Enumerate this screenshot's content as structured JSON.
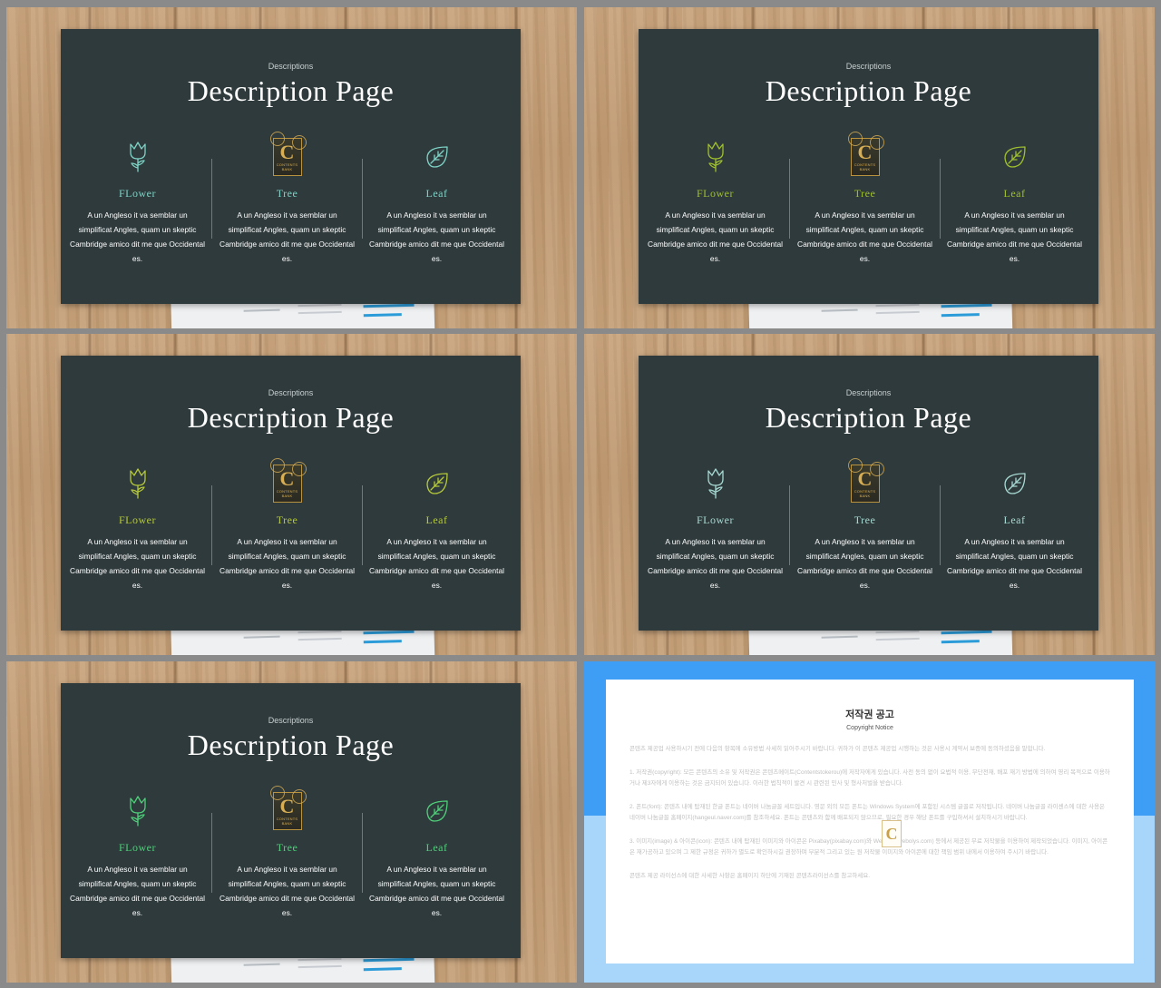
{
  "slides": [
    {
      "kicker": "Descriptions",
      "title": "Description Page",
      "accent": "#7ed3c6",
      "columns": [
        {
          "name": "FLower",
          "icon": "tulip-icon",
          "text": "A un Angleso it va semblar un simplificat Angles, quam un skeptic Cambridge amico dit me que Occidental es."
        },
        {
          "name": "Tree",
          "icon": "contents-logo",
          "text": "A un Angleso it va semblar un simplificat Angles, quam un skeptic Cambridge amico dit me que Occidental es."
        },
        {
          "name": "Leaf",
          "icon": "leaf-icon",
          "text": "A un Angleso it va semblar un simplificat Angles, quam un skeptic Cambridge amico dit me que Occidental es."
        }
      ]
    },
    {
      "kicker": "Descriptions",
      "title": "Description Page",
      "accent": "#9fbf2e",
      "columns": [
        {
          "name": "FLower",
          "icon": "tulip-icon",
          "text": "A un Angleso it va semblar un simplificat Angles, quam un skeptic Cambridge amico dit me que Occidental es."
        },
        {
          "name": "Tree",
          "icon": "contents-logo",
          "text": "A un Angleso it va semblar un simplificat Angles, quam un skeptic Cambridge amico dit me que Occidental es."
        },
        {
          "name": "Leaf",
          "icon": "leaf-icon",
          "text": "A un Angleso it va semblar un simplificat Angles, quam un skeptic Cambridge amico dit me que Occidental es."
        }
      ]
    },
    {
      "kicker": "Descriptions",
      "title": "Description Page",
      "accent": "#b5c93a",
      "columns": [
        {
          "name": "FLower",
          "icon": "tulip-icon",
          "text": "A un Angleso it va semblar un simplificat Angles, quam un skeptic Cambridge amico dit me que Occidental es."
        },
        {
          "name": "Tree",
          "icon": "contents-logo",
          "text": "A un Angleso it va semblar un simplificat Angles, quam un skeptic Cambridge amico dit me que Occidental es."
        },
        {
          "name": "Leaf",
          "icon": "leaf-icon",
          "text": "A un Angleso it va semblar un simplificat Angles, quam un skeptic Cambridge amico dit me que Occidental es."
        }
      ]
    },
    {
      "kicker": "Descriptions",
      "title": "Description Page",
      "accent": "#a7d9d3",
      "columns": [
        {
          "name": "FLower",
          "icon": "tulip-icon",
          "text": "A un Angleso it va semblar un simplificat Angles, quam un skeptic Cambridge amico dit me que Occidental es."
        },
        {
          "name": "Tree",
          "icon": "contents-logo",
          "text": "A un Angleso it va semblar un simplificat Angles, quam un skeptic Cambridge amico dit me que Occidental es."
        },
        {
          "name": "Leaf",
          "icon": "leaf-icon",
          "text": "A un Angleso it va semblar un simplificat Angles, quam un skeptic Cambridge amico dit me que Occidental es."
        }
      ]
    },
    {
      "kicker": "Descriptions",
      "title": "Description Page",
      "accent": "#4fcf7a",
      "columns": [
        {
          "name": "FLower",
          "icon": "tulip-icon",
          "text": "A un Angleso it va semblar un simplificat Angles, quam un skeptic Cambridge amico dit me que Occidental es."
        },
        {
          "name": "Tree",
          "icon": "contents-logo",
          "text": "A un Angleso it va semblar un simplificat Angles, quam un skeptic Cambridge amico dit me que Occidental es."
        },
        {
          "name": "Leaf",
          "icon": "leaf-icon",
          "text": "A un Angleso it va semblar un simplificat Angles, quam un skeptic Cambridge amico dit me que Occidental es."
        }
      ]
    }
  ],
  "copyright": {
    "title": "저작권 공고",
    "subtitle": "Copyright Notice",
    "paragraphs": [
      "콘텐츠 제공업 사용하시기 전에 다음의 항목에 소유방법 사세히 읽어주시기 바랍니다. 귀하가 이 콘텐츠 제공업 시행하는 것은 사용시 계약서 보증에 동의하셨음을 말합니다.",
      "1. 저작권(copyright): 모든 콘텐츠의 소유 및 저작권은 콘텐츠메이트(Contentstokerou)에 저작자에게 있습니다. 사전 동의 없이 요법적 이용, 무단전재, 배포 재기 방법에 의하여 영리 목적으로 이용하거나 제3자에게 이용하는 것은 금지되어 있습니다. 이러한 법칙적이 발견 시 관련된 민사 및 형사처벌을 받습니다.",
      "2. 폰트(font): 콘텐츠 내에 탑재된 한글 폰트는 네이버 나눔글꼴 세트입니다. 영문 외의 모든 폰트는 Windows System에 포함된 시스템 글꼴로 저작됩니다. 네이버 나눔글꼴 라이센스에 대한 사용은 네이버 나눔글꼴 홈페이지(hangeul.naver.com)를 참조하세요. 폰트는 콘텐츠와 함께 배포되지 않으므로, 필요한 경우 해당 폰트를 구입하셔서 설치하시기 바랍니다.",
      "3. 이미지(image) & 아이콘(icon): 콘텐츠 내에 탑재된 이미지와 아이콘은 Pixabay(pixabay.com)와 Webolys(webolys.com) 등에서 제공된 무료 저작물을 이용하여 제작되었습니다. 이미지, 아이콘은 재가공하고 있으며 그 제한 규정은 귀하가 별도로 확인하시길 권장하며 부분적 그리고 있는 원 저작물 이미지와 아이콘에 대한 책임 범위 내에서 이용하여 주시기 바랍니다.",
      "콘텐츠 제공 라이선스에 대한 사세한 사항은 홈페이지 하단에 기재된 콘텐츠라이선스를 참고하세요."
    ],
    "logo_letter": "C"
  },
  "logo": {
    "letter": "C",
    "line1": "CONTENTS",
    "line2": "BANK"
  }
}
